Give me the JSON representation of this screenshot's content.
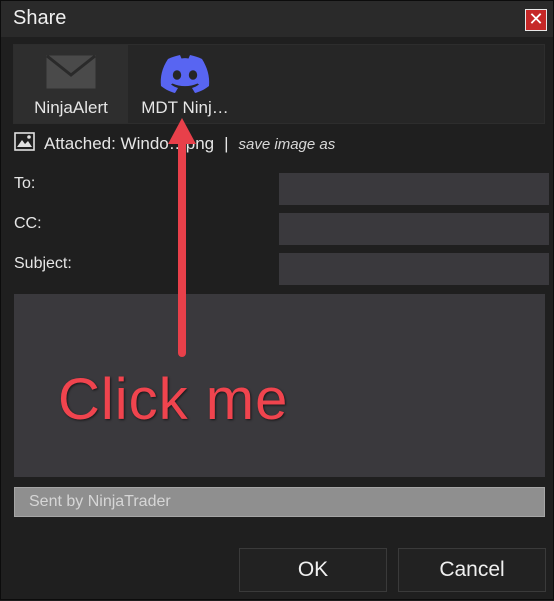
{
  "window": {
    "title": "Share",
    "close_icon": "close-icon"
  },
  "services": [
    {
      "label": "NinjaAlert",
      "icon": "envelope-icon",
      "selected": true
    },
    {
      "label": "MDT Ninj…",
      "icon": "discord-icon",
      "selected": false
    }
  ],
  "attachment": {
    "icon": "image-icon",
    "text": "Attached: Windo…png",
    "separator": "|",
    "save_link": "save image as"
  },
  "fields": {
    "to_label": "To:",
    "cc_label": "CC:",
    "subject_label": "Subject:",
    "to_value": "",
    "cc_value": "",
    "subject_value": ""
  },
  "message": {
    "body": "",
    "signature": "Sent by NinjaTrader"
  },
  "buttons": {
    "ok": "OK",
    "cancel": "Cancel"
  },
  "annotation": {
    "text": "Click me",
    "color": "#f0444e"
  },
  "colors": {
    "discord": "#5865F2",
    "close": "#c62828"
  }
}
